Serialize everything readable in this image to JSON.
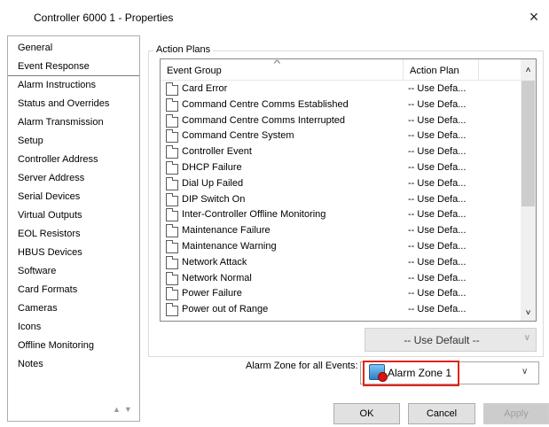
{
  "window": {
    "title": "Controller 6000 1 - Properties",
    "close_glyph": "×"
  },
  "sidebar": {
    "items": [
      {
        "label": "General"
      },
      {
        "label": "Event Response"
      },
      {
        "label": "Alarm Instructions"
      },
      {
        "label": "Status and Overrides"
      },
      {
        "label": "Alarm Transmission"
      },
      {
        "label": "Setup"
      },
      {
        "label": "Controller Address"
      },
      {
        "label": "Server Address"
      },
      {
        "label": "Serial Devices"
      },
      {
        "label": "Virtual Outputs"
      },
      {
        "label": "EOL Resistors"
      },
      {
        "label": "HBUS Devices"
      },
      {
        "label": "Software"
      },
      {
        "label": "Card Formats"
      },
      {
        "label": "Cameras"
      },
      {
        "label": "Icons"
      },
      {
        "label": "Offline Monitoring"
      },
      {
        "label": "Notes"
      }
    ],
    "selected": "Event Response",
    "scroll_glyphs": "▲▼"
  },
  "action_plans": {
    "group_label": "Action Plans",
    "columns": {
      "event_group": "Event Group",
      "action_plan": "Action Plan"
    },
    "rows": [
      {
        "group": "Card Error",
        "plan": "-- Use Defa..."
      },
      {
        "group": "Command Centre Comms Established",
        "plan": "-- Use Defa..."
      },
      {
        "group": "Command Centre Comms Interrupted",
        "plan": "-- Use Defa..."
      },
      {
        "group": "Command Centre System",
        "plan": "-- Use Defa..."
      },
      {
        "group": "Controller Event",
        "plan": "-- Use Defa..."
      },
      {
        "group": "DHCP Failure",
        "plan": "-- Use Defa..."
      },
      {
        "group": "Dial Up Failed",
        "plan": "-- Use Defa..."
      },
      {
        "group": "DIP Switch On",
        "plan": "-- Use Defa..."
      },
      {
        "group": "Inter-Controller Offline Monitoring",
        "plan": "-- Use Defa..."
      },
      {
        "group": "Maintenance Failure",
        "plan": "-- Use Defa..."
      },
      {
        "group": "Maintenance Warning",
        "plan": "-- Use Defa..."
      },
      {
        "group": "Network Attack",
        "plan": "-- Use Defa..."
      },
      {
        "group": "Network Normal",
        "plan": "-- Use Defa..."
      },
      {
        "group": "Power Failure",
        "plan": "-- Use Defa..."
      },
      {
        "group": "Power out of Range",
        "plan": "-- Use Defa..."
      }
    ],
    "plan_combo_value": "-- Use Default --"
  },
  "alarm_zone": {
    "label": "Alarm Zone for all Events:",
    "value": "Alarm Zone 1",
    "icon": "alarm-zone-icon"
  },
  "buttons": {
    "ok": "OK",
    "cancel": "Cancel",
    "apply": "Apply"
  },
  "colors": {
    "highlight_border": "#e2231a",
    "disabled_text": "#a0a0a0"
  }
}
